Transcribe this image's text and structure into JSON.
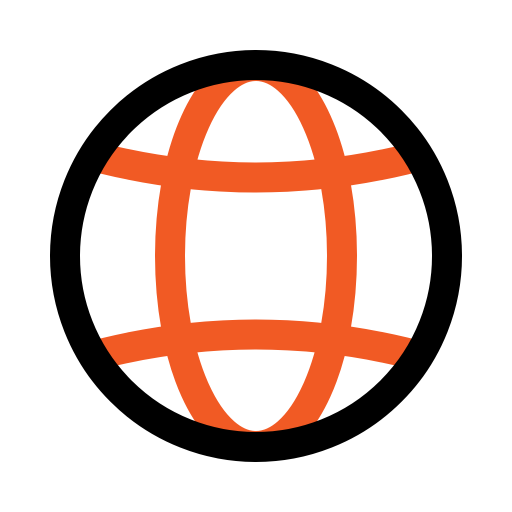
{
  "icon": {
    "name": "globe-icon",
    "outline_color": "#000000",
    "grid_color": "#F15A24",
    "background_color": "#FFFFFF"
  }
}
